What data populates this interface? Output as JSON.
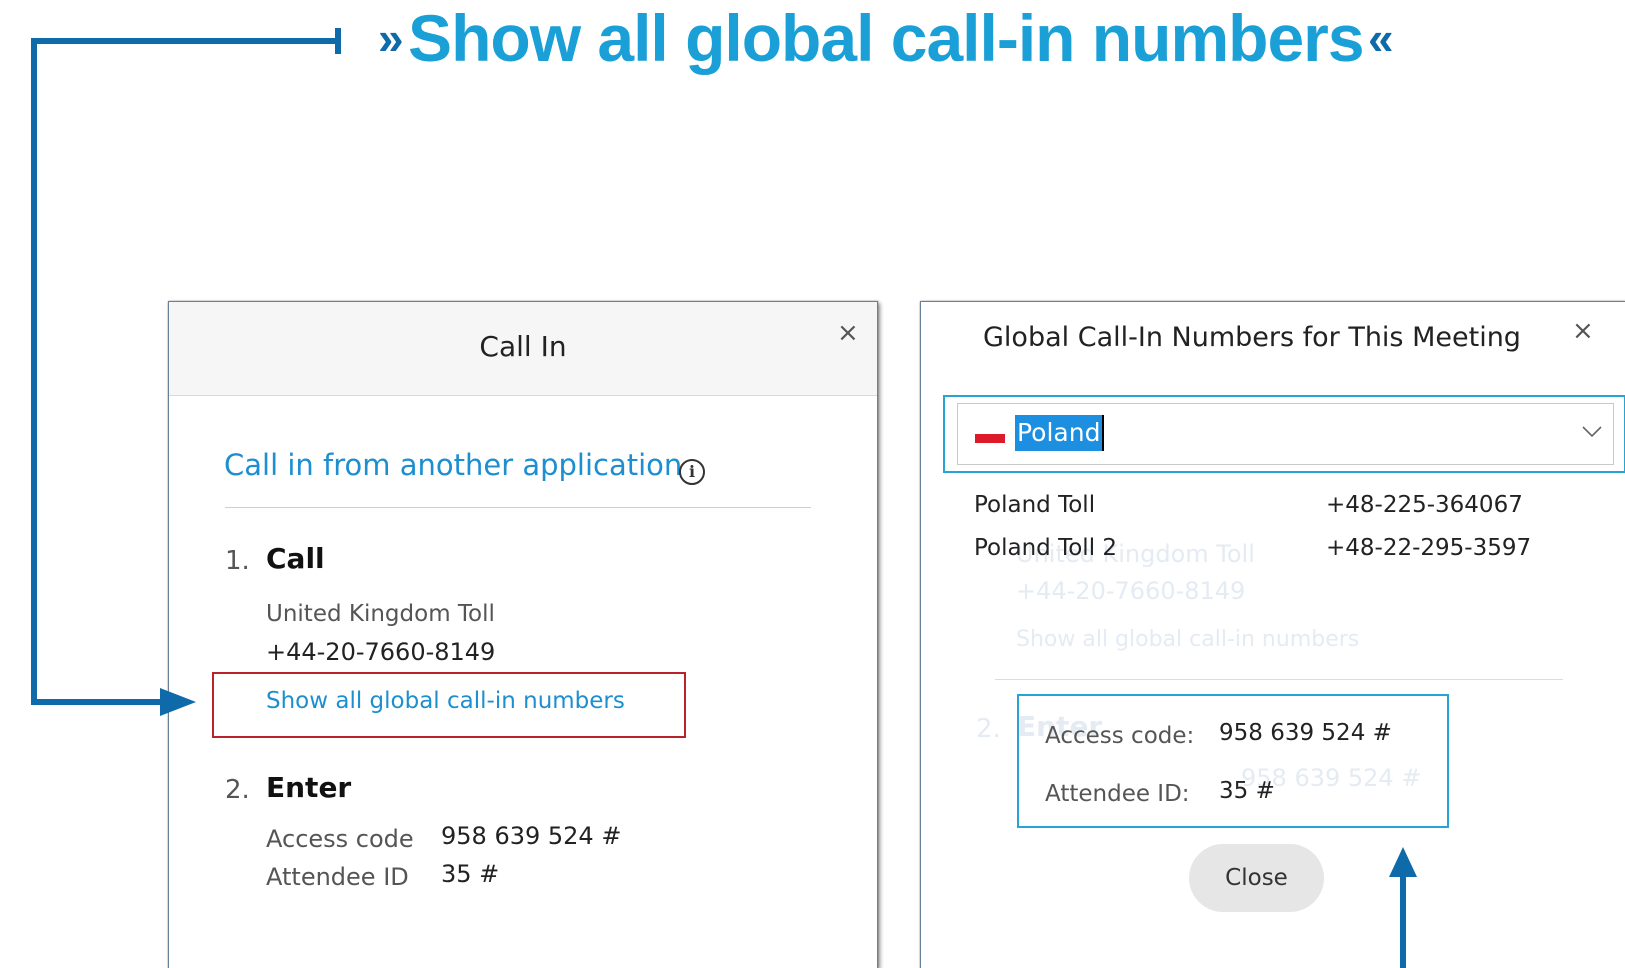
{
  "headline": {
    "open_quote": "»",
    "text": "Show all global call-in numbers",
    "close_quote": "«"
  },
  "left_dialog": {
    "title": "Call In",
    "close_glyph": "×",
    "app_link": "Call in from another application",
    "info_glyph": "i",
    "step1": {
      "number": "1.",
      "label": "Call"
    },
    "toll_label": "United Kingdom Toll",
    "toll_number": "+44-20-7660-8149",
    "show_all_link": "Show all global call-in numbers",
    "step2": {
      "number": "2.",
      "label": "Enter"
    },
    "access_code_label": "Access code",
    "access_code_value": "958 639 524 #",
    "attendee_label": "Attendee ID",
    "attendee_value": "35 #"
  },
  "right_dialog": {
    "title": "Global Call-In Numbers for This Meeting",
    "close_glyph": "×",
    "country_select": {
      "value": "Poland",
      "flag_color": "#dc1a2a"
    },
    "numbers": [
      {
        "label": "Poland Toll",
        "number": "+48-225-364067"
      },
      {
        "label": "Poland Toll 2",
        "number": "+48-22-295-3597"
      }
    ],
    "background_toll_label": "United Kingdom Toll",
    "background_toll_number": "+44-20-7660-8149",
    "background_show_all": "Show all global call-in numbers",
    "background_step2_number": "2.",
    "background_step2_label": "Enter",
    "background_code_value": "958 639 524 #",
    "access_code_label": "Access code:",
    "access_code_value": "958 639 524 #",
    "attendee_label": "Attendee ID:",
    "attendee_value": "35 #",
    "close_button": "Close"
  },
  "colors": {
    "accent_blue": "#1d8fd0",
    "headline_blue": "#1aa0d6",
    "arrow_blue": "#0e6aa8",
    "highlight_red": "#b8222a",
    "selection_blue": "#1c8fe0"
  }
}
